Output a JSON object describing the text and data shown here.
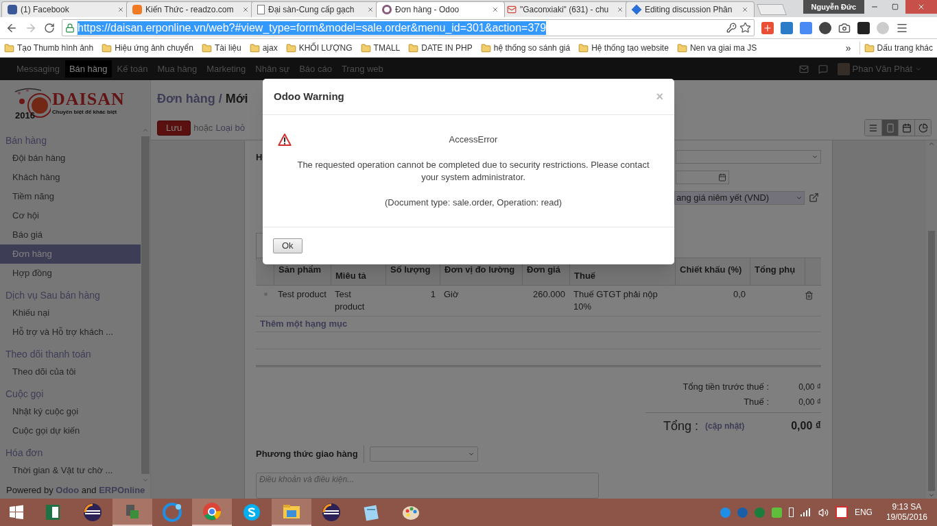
{
  "browser": {
    "tabs": [
      {
        "label": "(1) Facebook",
        "selected": false
      },
      {
        "label": "Kiến Thức - readzo.com",
        "selected": false
      },
      {
        "label": "Đại sàn-Cung cấp gạch",
        "selected": false
      },
      {
        "label": "Đơn hàng - Odoo",
        "selected": true
      },
      {
        "label": "\"Gaconxiaki\" (631) - chu",
        "selected": false
      },
      {
        "label": "Editing discussion Phân",
        "selected": false
      }
    ],
    "profile": "Nguyễn Đức",
    "url": "https://daisan.erponline.vn/web?#view_type=form&model=sale.order&menu_id=301&action=379",
    "bookmarks": [
      "Tạo Thumb hình ảnh",
      "Hiệu ứng ảnh chuyển",
      "Tài liệu",
      "ajax",
      "KHỐI LƯỢNG",
      "TMALL",
      "DATE IN PHP",
      "hệ thống so sánh giá",
      "Hệ thống tạo website",
      "Nen va giai ma JS"
    ],
    "more": "»",
    "other_bookmarks": "Dấu trang khác"
  },
  "topbar": {
    "menu": [
      {
        "label": "Messaging",
        "selected": false
      },
      {
        "label": "Bán hàng",
        "selected": true
      },
      {
        "label": "Kế toán",
        "selected": false
      },
      {
        "label": "Mua hàng",
        "selected": false
      },
      {
        "label": "Marketing",
        "selected": false
      },
      {
        "label": "Nhân sự",
        "selected": false
      },
      {
        "label": "Báo cáo",
        "selected": false
      },
      {
        "label": "Trang web",
        "selected": false
      }
    ],
    "user": "Phan Văn Phát"
  },
  "sidebar": {
    "logo": {
      "name": "DAISAN",
      "tagline": "Chuyên biệt để khác biệt",
      "year": "2016"
    },
    "sections": [
      {
        "title": "Bán hàng",
        "items": [
          {
            "label": "Đội bán hàng",
            "selected": false
          },
          {
            "label": "Khách hàng",
            "selected": false
          },
          {
            "label": "Tiềm năng",
            "selected": false
          },
          {
            "label": "Cơ hội",
            "selected": false
          },
          {
            "label": "Báo giá",
            "selected": false
          },
          {
            "label": "Đơn hàng",
            "selected": true
          },
          {
            "label": "Hợp đồng",
            "selected": false
          }
        ]
      },
      {
        "title": "Dịch vụ Sau bán hàng",
        "items": [
          {
            "label": "Khiếu nại",
            "selected": false
          },
          {
            "label": "Hỗ trợ và Hỗ trợ khách ...",
            "selected": false
          }
        ]
      },
      {
        "title": "Theo dõi thanh toán",
        "items": [
          {
            "label": "Theo dõi của tôi",
            "selected": false
          }
        ]
      },
      {
        "title": "Cuộc gọi",
        "items": [
          {
            "label": "Nhật ký cuộc gọi",
            "selected": false
          },
          {
            "label": "Cuộc gọi dự kiến",
            "selected": false
          }
        ]
      },
      {
        "title": "Hóa đơn",
        "items": [
          {
            "label": "Thời gian & Vật tư chờ ...",
            "selected": false
          }
        ]
      }
    ],
    "footer": {
      "prefix": "Powered by",
      "brand": "Odoo",
      "joiner": "and",
      "partner": "ERPOnline"
    }
  },
  "header": {
    "breadcrumb": "Đơn hàng",
    "separator": "/",
    "current": "Mới",
    "save": "Lưu",
    "or": "hoặc",
    "discard": "Loại bỏ",
    "views": [
      {
        "kind": "list",
        "selected": false
      },
      {
        "kind": "form",
        "selected": true
      },
      {
        "kind": "calendar",
        "selected": false
      },
      {
        "kind": "graph",
        "selected": false
      }
    ]
  },
  "form": {
    "label_fragment": "H",
    "pricelist": "ang giá niêm yết (VND)",
    "columns": [
      "Sản phẩm",
      "Miêu tả",
      "Số lượng",
      "Đơn vị đo lường",
      "Đơn giá",
      "Thuế",
      "Chiết khấu (%)",
      "Tổng phụ"
    ],
    "rows": [
      {
        "product": "Test product",
        "description": "Test product",
        "quantity": "1",
        "unit": "Giờ",
        "price": "260.000",
        "tax": "Thuế GTGT phải nộp 10%",
        "discount": "0,0"
      }
    ],
    "add_line": "Thêm một hạng mục",
    "totals": [
      {
        "label": "Tổng tiền trước thuế :",
        "value": "0,00 ₫"
      },
      {
        "label": "Thuế :",
        "value": "0,00 ₫"
      }
    ],
    "total": {
      "label": "Tổng :",
      "update": "(cập nhật)",
      "value": "0,00 ₫"
    },
    "delivery_label": "Phương thức giao hàng",
    "terms": {
      "placeholder": "Điều khoản và điều kiện..."
    }
  },
  "dialog": {
    "title": "Odoo Warning",
    "close": "×",
    "error": "AccessError",
    "message": "The requested operation cannot be completed due to security restrictions. Please contact your system administrator.",
    "detail": "(Document type: sale.order, Operation: read)",
    "button": "Ok"
  },
  "taskbar": {
    "apps": [
      {
        "kind": "spreadsheet",
        "selected": false
      },
      {
        "kind": "eclipse",
        "selected": false
      },
      {
        "kind": "network",
        "selected": true
      },
      {
        "kind": "cleaner",
        "selected": false
      },
      {
        "kind": "chrome",
        "selected": true
      },
      {
        "kind": "skype",
        "selected": false
      },
      {
        "kind": "folder",
        "selected": true
      },
      {
        "kind": "eclipse",
        "selected": false
      },
      {
        "kind": "notepad",
        "selected": false
      },
      {
        "kind": "paint",
        "selected": false
      }
    ],
    "language": "ENG",
    "time": "9:13 SA",
    "date": "19/05/2016"
  }
}
